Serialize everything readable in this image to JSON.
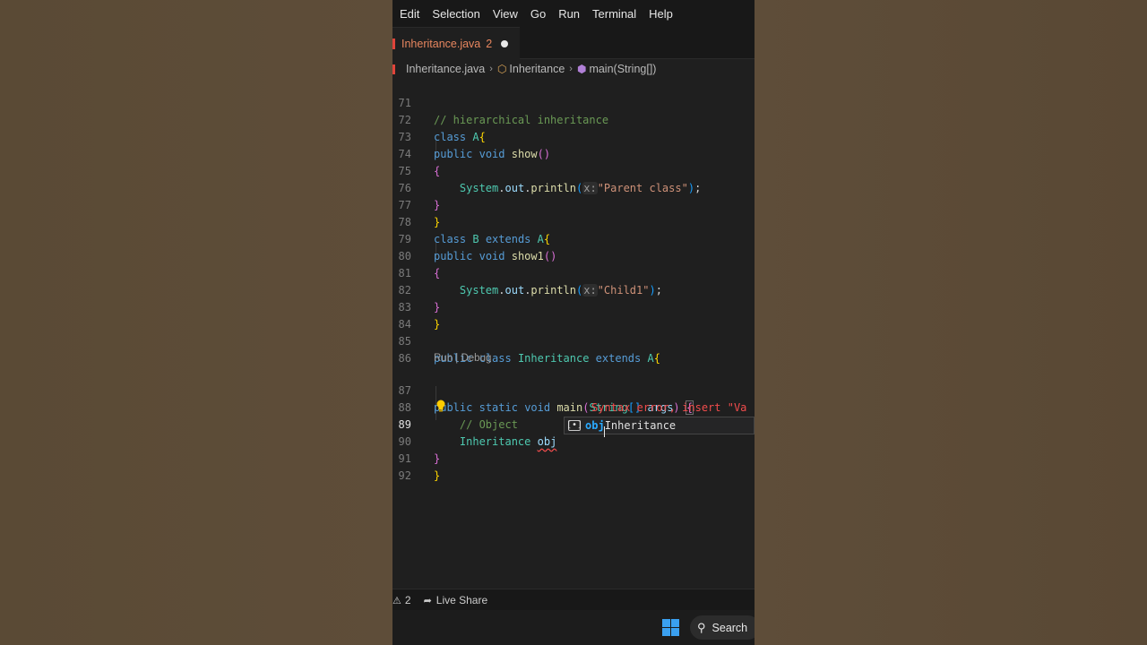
{
  "menu": [
    "Edit",
    "Selection",
    "View",
    "Go",
    "Run",
    "Terminal",
    "Help"
  ],
  "tab": {
    "label": "Inheritance.java",
    "problems": "2"
  },
  "breadcrumb": {
    "file": "Inheritance.java",
    "class": "Inheritance",
    "method": "main(String[])"
  },
  "codelens": "Run | Debug",
  "line_numbers": [
    "71",
    "72",
    "73",
    "74",
    "75",
    "76",
    "77",
    "78",
    "79",
    "80",
    "81",
    "82",
    "83",
    "84",
    "85",
    "86",
    "87",
    "88",
    "89",
    "90",
    "91",
    "92"
  ],
  "active_line": "89",
  "code": {
    "l71": "// hierarchical inheritance",
    "l72_kw": "class",
    "l72_name": "A",
    "l72_b": "{",
    "l73_kw1": "public",
    "l73_kw2": "void",
    "l73_fn": "show",
    "l73_p": "()",
    "l74": "{",
    "l75_obj": "System",
    "l75_dot1": ".",
    "l75_out": "out",
    "l75_dot2": ".",
    "l75_fn": "println",
    "l75_p1": "(",
    "l75_hint": "x:",
    "l75_str": "\"Parent class\"",
    "l75_p2": ")",
    "l75_semi": ";",
    "l76": "}",
    "l77": "}",
    "l78_kw1": "class",
    "l78_name": "B",
    "l78_kw2": "extends",
    "l78_sup": "A",
    "l78_b": "{",
    "l79_kw1": "public",
    "l79_kw2": "void",
    "l79_fn": "show1",
    "l79_p": "()",
    "l80": "{",
    "l81_obj": "System",
    "l81_dot1": ".",
    "l81_out": "out",
    "l81_dot2": ".",
    "l81_fn": "println",
    "l81_p1": "(",
    "l81_hint": "x:",
    "l81_str": "\"Child1\"",
    "l81_p2": ")",
    "l81_semi": ";",
    "l82": "}",
    "l83": "}",
    "l85_kw1": "public",
    "l85_kw2": "class",
    "l85_name": "Inheritance",
    "l85_kw3": "extends",
    "l85_sup": "A",
    "l85_b": "{",
    "l87_kw1": "public",
    "l87_kw2": "static",
    "l87_kw3": "void",
    "l87_fn": "main",
    "l87_p1": "(",
    "l87_ty": "String",
    "l87_arr": "[]",
    "l87_arg": "args",
    "l87_p2": ")",
    "l87_b": "{",
    "l88": "// Object",
    "l89_ty": "Inheritance",
    "l89_var": "obj",
    "l90": "}",
    "l91": "}"
  },
  "error_message": "Syntax error, insert \"Va",
  "suggestion": {
    "match": "obj",
    "rest": "Inheritance"
  },
  "status": {
    "problems": "2",
    "live_share": "Live Share"
  },
  "taskbar": {
    "search": "Search"
  }
}
